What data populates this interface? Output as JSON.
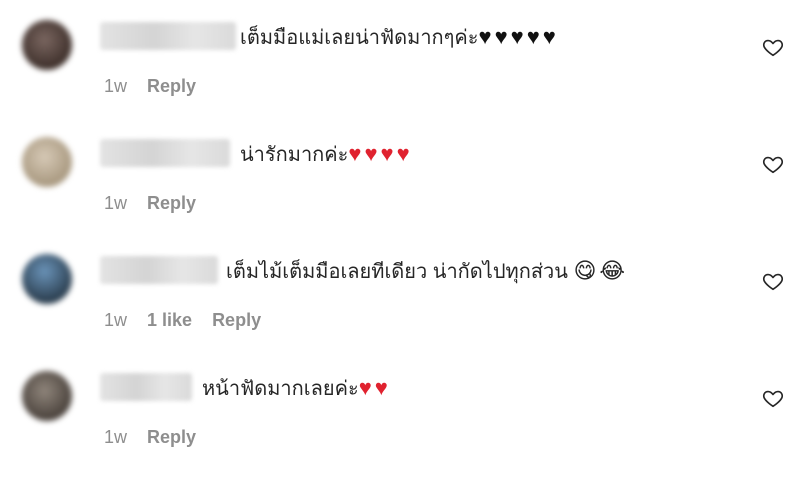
{
  "comments": [
    {
      "username": "blurred_user_1",
      "text": "เต็มมือแม่เลยน่าฟัดมากๆค่ะ",
      "emoji": "♥♥♥♥♥",
      "time": "1w",
      "likes": "",
      "reply": "Reply",
      "avatar_color": "#4a3b36"
    },
    {
      "username": "blurred_user_2",
      "text": "น่ารักมากค่ะ",
      "emoji": "♥♥♥♥",
      "time": "1w",
      "likes": "",
      "reply": "Reply",
      "avatar_color": "#b9ab98"
    },
    {
      "username": "blurred_user_3",
      "text": "เต็มไม้เต็มมือเลยทีเดียว น่ากัดไปทุกส่วน",
      "emoji": "😋😂",
      "time": "1w",
      "likes": "1 like",
      "reply": "Reply",
      "avatar_color": "#3c5a78"
    },
    {
      "username": "blurred_user_4",
      "text": "หน้าฟัดมากเลยค่ะ",
      "emoji": "♥♥",
      "time": "1w",
      "likes": "",
      "reply": "Reply",
      "avatar_color": "#6b625a"
    }
  ]
}
